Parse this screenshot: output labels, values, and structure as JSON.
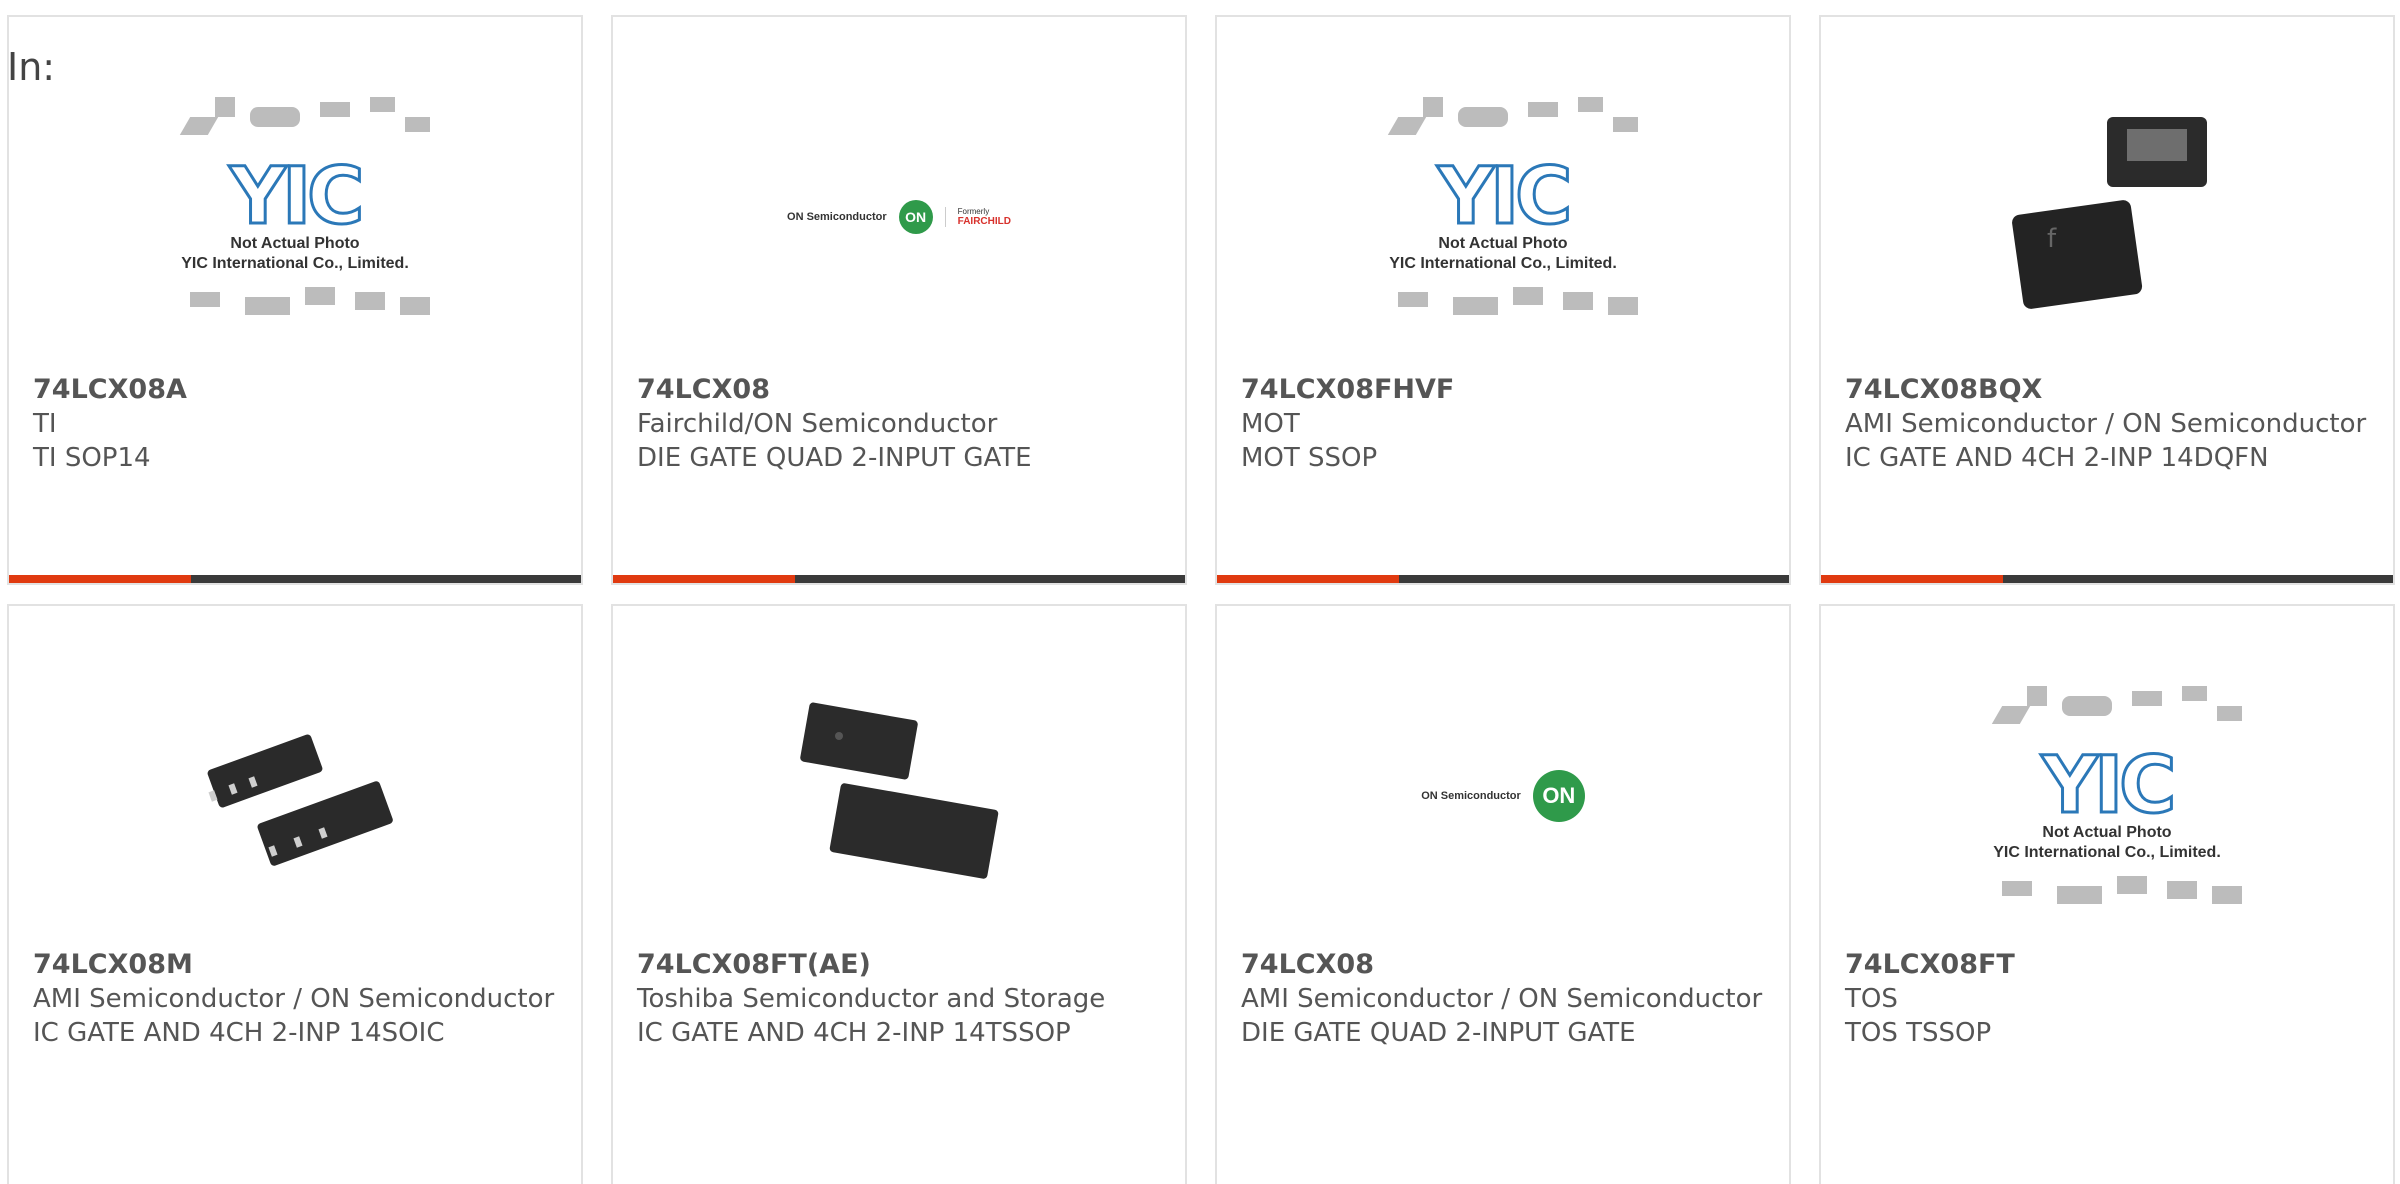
{
  "filter_label": "In:",
  "placeholder_caption_line1": "Not Actual Photo",
  "placeholder_caption_line2": "YIC International Co., Limited.",
  "logos": {
    "on_text": "ON Semiconductor",
    "on_mark": "ON",
    "fairchild_formerly": "Formerly",
    "fairchild_name": "FAIRCHILD"
  },
  "colors": {
    "accent": "#e03a10",
    "bar": "#3a3a3a",
    "border": "#e2e2e2",
    "text": "#555555"
  },
  "products": [
    {
      "part": "74LCX08A",
      "manufacturer": "TI",
      "description": "TI SOP14",
      "image": "placeholder-icon"
    },
    {
      "part": "74LCX08",
      "manufacturer": "Fairchild/ON Semiconductor",
      "description": "DIE GATE QUAD 2-INPUT GATE",
      "image": "on-fairchild-logo"
    },
    {
      "part": "74LCX08FHVF",
      "manufacturer": "MOT",
      "description": "MOT SSOP",
      "image": "placeholder-icon"
    },
    {
      "part": "74LCX08BQX",
      "manufacturer": "AMI Semiconductor / ON Semiconductor",
      "description": "IC GATE AND 4CH 2-INP 14DQFN",
      "image": "dqfn-chip-icon"
    },
    {
      "part": "74LCX08M",
      "manufacturer": "AMI Semiconductor / ON Semiconductor",
      "description": "IC GATE AND 4CH 2-INP 14SOIC",
      "image": "soic-chip-icon"
    },
    {
      "part": "74LCX08FT(AE)",
      "manufacturer": "Toshiba Semiconductor and Storage",
      "description": "IC GATE AND 4CH 2-INP 14TSSOP",
      "image": "tssop-chip-icon"
    },
    {
      "part": "74LCX08",
      "manufacturer": "AMI Semiconductor / ON Semiconductor",
      "description": "DIE GATE QUAD 2-INPUT GATE",
      "image": "on-semiconductor-logo"
    },
    {
      "part": "74LCX08FT",
      "manufacturer": "TOS",
      "description": "TOS TSSOP",
      "image": "placeholder-icon"
    }
  ]
}
